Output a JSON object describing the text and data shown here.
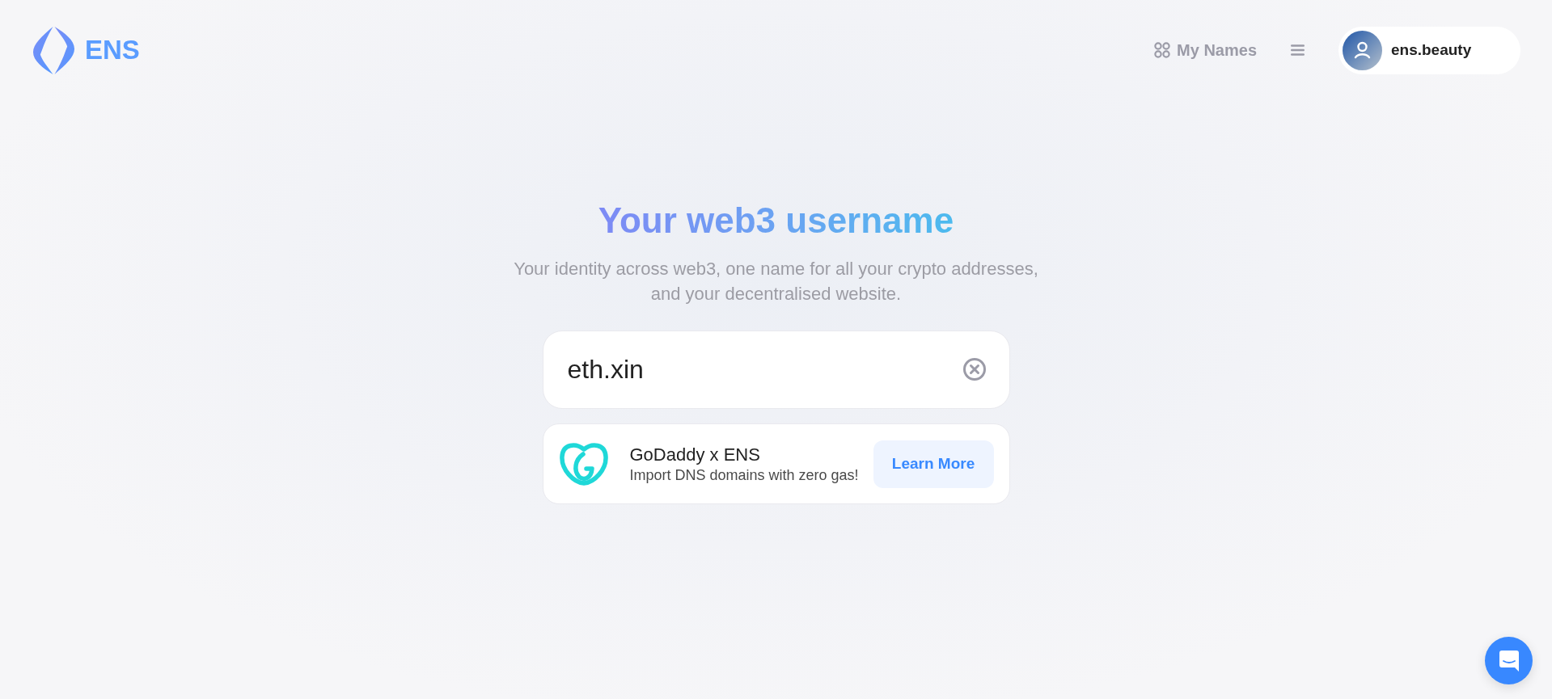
{
  "header": {
    "logo_text": "ENS",
    "nav": [
      {
        "label": "My Names"
      }
    ],
    "account": {
      "name": "ens.beauty"
    }
  },
  "hero": {
    "title": "Your web3 username",
    "subtitle": "Your identity across web3, one name for all your crypto addresses, and your decentralised website."
  },
  "search": {
    "value": "eth.xin"
  },
  "promo": {
    "title": "GoDaddy x ENS",
    "subtitle": "Import DNS domains with zero gas!",
    "button": "Learn More"
  }
}
